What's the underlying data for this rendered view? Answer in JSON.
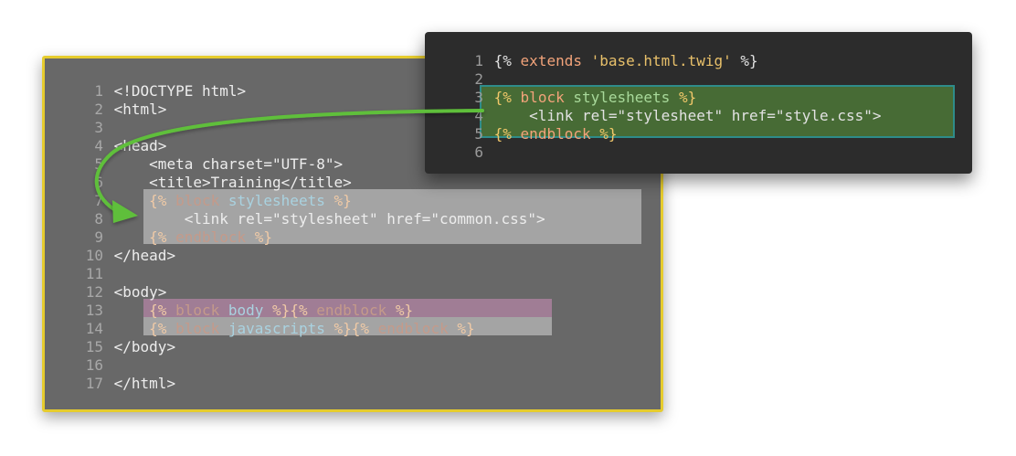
{
  "base_template": {
    "lines": [
      {
        "num": "1",
        "tokens": [
          {
            "cls": "t-base",
            "text": "<!DOCTYPE html>"
          }
        ]
      },
      {
        "num": "2",
        "tokens": [
          {
            "cls": "t-base",
            "text": "<html>"
          }
        ]
      },
      {
        "num": "3",
        "tokens": []
      },
      {
        "num": "4",
        "tokens": [
          {
            "cls": "t-base",
            "text": "<head>"
          }
        ]
      },
      {
        "num": "5",
        "tokens": [
          {
            "cls": "t-base",
            "text": "    <meta charset=\"UTF-8\">"
          }
        ]
      },
      {
        "num": "6",
        "tokens": [
          {
            "cls": "t-base",
            "text": "    <title>Training</title>"
          }
        ]
      },
      {
        "num": "7",
        "tokens": [
          {
            "cls": "t-twig",
            "text": "    {% "
          },
          {
            "cls": "t-kw",
            "text": "block "
          },
          {
            "cls": "t-name",
            "text": "stylesheets"
          },
          {
            "cls": "t-twig",
            "text": " %}"
          }
        ]
      },
      {
        "num": "8",
        "tokens": [
          {
            "cls": "t-base",
            "text": "        <link rel=\"stylesheet\" href=\"common.css\">"
          }
        ]
      },
      {
        "num": "9",
        "tokens": [
          {
            "cls": "t-twig",
            "text": "    {% "
          },
          {
            "cls": "t-kw",
            "text": "endblock"
          },
          {
            "cls": "t-twig",
            "text": " %}"
          }
        ]
      },
      {
        "num": "10",
        "tokens": [
          {
            "cls": "t-base",
            "text": "</head>"
          }
        ]
      },
      {
        "num": "11",
        "tokens": []
      },
      {
        "num": "12",
        "tokens": [
          {
            "cls": "t-base",
            "text": "<body>"
          }
        ]
      },
      {
        "num": "13",
        "tokens": [
          {
            "cls": "t-twig",
            "text": "    {% "
          },
          {
            "cls": "t-kw",
            "text": "block "
          },
          {
            "cls": "t-name",
            "text": "body"
          },
          {
            "cls": "t-twig",
            "text": " %}{% "
          },
          {
            "cls": "t-kw",
            "text": "endblock"
          },
          {
            "cls": "t-twig",
            "text": " %}"
          }
        ]
      },
      {
        "num": "14",
        "tokens": [
          {
            "cls": "t-twig",
            "text": "    {% "
          },
          {
            "cls": "t-kw",
            "text": "block "
          },
          {
            "cls": "t-name",
            "text": "javascripts"
          },
          {
            "cls": "t-twig",
            "text": " %}{% "
          },
          {
            "cls": "t-kw",
            "text": "endblock"
          },
          {
            "cls": "t-twig",
            "text": " %}"
          }
        ]
      },
      {
        "num": "15",
        "tokens": [
          {
            "cls": "t-base",
            "text": "</body>"
          }
        ]
      },
      {
        "num": "16",
        "tokens": []
      },
      {
        "num": "17",
        "tokens": [
          {
            "cls": "t-base",
            "text": "</html>"
          }
        ]
      }
    ]
  },
  "child_template": {
    "lines": [
      {
        "num": "1",
        "tokens": [
          {
            "cls": "c-plain",
            "text": "{% "
          },
          {
            "cls": "c-kw",
            "text": "extends "
          },
          {
            "cls": "c-str",
            "text": "'base.html.twig'"
          },
          {
            "cls": "c-plain",
            "text": " %}"
          }
        ]
      },
      {
        "num": "2",
        "tokens": []
      },
      {
        "num": "3",
        "tokens": [
          {
            "cls": "c-tag",
            "text": "{% "
          },
          {
            "cls": "c-kw",
            "text": "block "
          },
          {
            "cls": "c-name",
            "text": "stylesheets"
          },
          {
            "cls": "c-tag",
            "text": " %}"
          }
        ]
      },
      {
        "num": "4",
        "tokens": [
          {
            "cls": "c-plain",
            "text": "    <link rel=\"stylesheet\" href=\"style.css\">"
          }
        ]
      },
      {
        "num": "5",
        "tokens": [
          {
            "cls": "c-tag",
            "text": "{% "
          },
          {
            "cls": "c-kw",
            "text": "endblock"
          },
          {
            "cls": "c-tag",
            "text": " %}"
          }
        ]
      },
      {
        "num": "6",
        "tokens": []
      }
    ]
  },
  "colors": {
    "base_panel_bg": "#686868",
    "base_panel_border": "#e6cc2e",
    "child_panel_bg": "#2c2c2c",
    "override_highlight": "#476b35",
    "override_highlight_border": "#2e8c8a",
    "block_highlight": "#a4a4a4",
    "body_block_highlight": "#a07d95",
    "arrow": "#5fbf3a"
  }
}
